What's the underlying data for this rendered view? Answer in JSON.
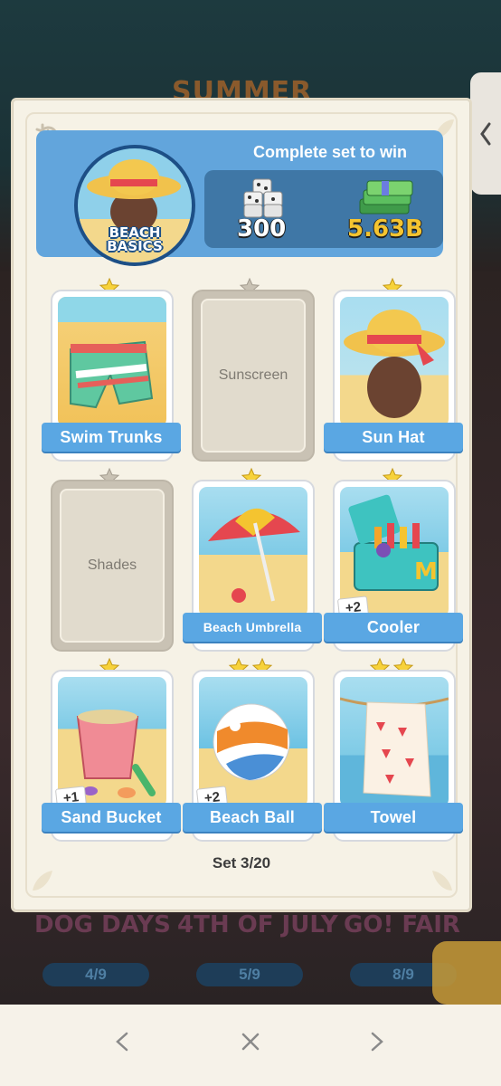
{
  "background": {
    "event_title": "SUMMER",
    "other_sets": [
      {
        "name": "DOG DAYS",
        "progress": "4/9"
      },
      {
        "name": "4TH OF JULY",
        "progress": "5/9"
      },
      {
        "name": "GO! FAIR",
        "progress": "8/9"
      }
    ]
  },
  "header": {
    "title": "Complete set to win",
    "set_name_line1": "BEACH",
    "set_name_line2": "BASICS",
    "rewards": [
      {
        "icon": "dice-stack-icon",
        "value": "300"
      },
      {
        "icon": "cash-stack-icon",
        "value": "5.63B"
      }
    ]
  },
  "cards": [
    {
      "name": "Swim Trunks",
      "stars": 1,
      "owned": true,
      "extra": ""
    },
    {
      "name": "Sunscreen",
      "stars": 1,
      "owned": false,
      "extra": ""
    },
    {
      "name": "Sun Hat",
      "stars": 1,
      "owned": true,
      "extra": ""
    },
    {
      "name": "Shades",
      "stars": 1,
      "owned": false,
      "extra": ""
    },
    {
      "name": "Beach Umbrella",
      "stars": 1,
      "owned": true,
      "extra": ""
    },
    {
      "name": "Cooler",
      "stars": 1,
      "owned": true,
      "extra": "+2"
    },
    {
      "name": "Sand Bucket",
      "stars": 1,
      "owned": true,
      "extra": "+1"
    },
    {
      "name": "Beach Ball",
      "stars": 2,
      "owned": true,
      "extra": "+2"
    },
    {
      "name": "Towel",
      "stars": 2,
      "owned": true,
      "extra": ""
    }
  ],
  "footer": {
    "set_counter": "Set 3/20"
  },
  "nav": {
    "prev_icon": "chevron-left-icon",
    "close_icon": "close-icon",
    "next_icon": "chevron-right-icon"
  },
  "colors": {
    "accent": "#5aa7e3",
    "header": "#62a5dc",
    "reward_gold": "#f4c430",
    "star_gold": "#f7d23a",
    "star_grey": "#c9c2b4"
  }
}
